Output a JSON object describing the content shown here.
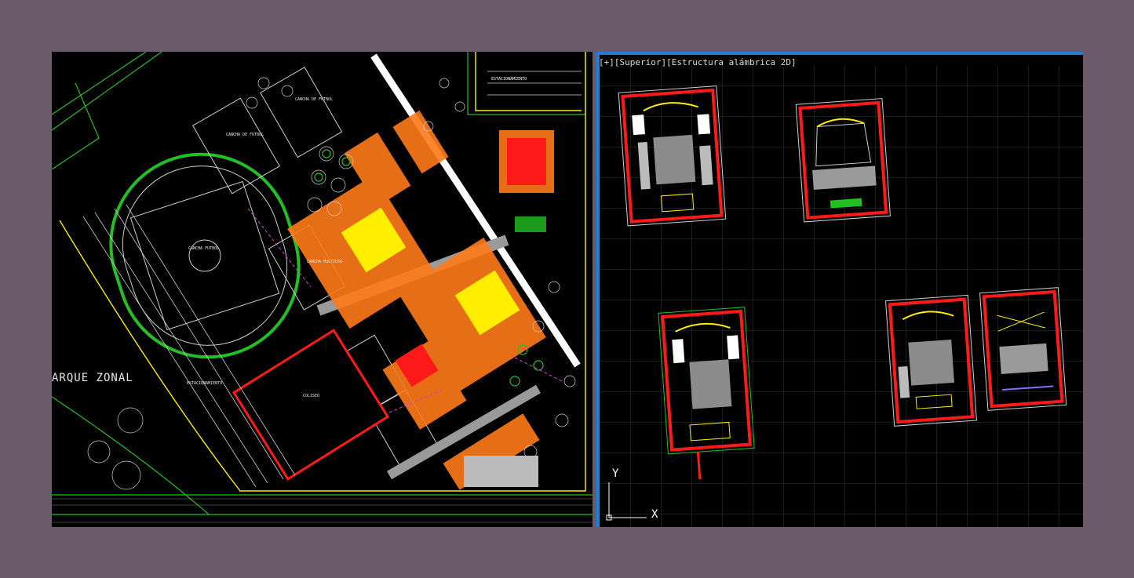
{
  "left_viewport": {
    "zone_label": "ARQUE ZONAL",
    "labels": {
      "estacionamiento_top": "ESTACIONAMIENTO",
      "cancha_futbol_1": "CANCHA DE FUTBOL",
      "cancha_futbol_2": "CANCHA DE FUTBOL",
      "cancha_futbol_3": "CANCHA FUTBOL",
      "cancha_multiuso": "CANCHA MULTIUSO",
      "coliseo": "COLISEO",
      "estacionamiento_bottom": "ESTACIONAMIENTO"
    }
  },
  "right_viewport": {
    "header": "[+][Superior][Estructura alámbrica 2D]",
    "ucs_x": "X",
    "ucs_y": "Y"
  },
  "colors": {
    "background": "#6a5a6b",
    "canvas": "#000000",
    "accent": "#1e7fd8",
    "red": "#ff1a1a",
    "green": "#22c022",
    "yellow": "#ffee00",
    "white": "#ffffff",
    "magenta": "#d040d0",
    "orange": "#ff7a1a",
    "grid": "#2e3a2e"
  }
}
